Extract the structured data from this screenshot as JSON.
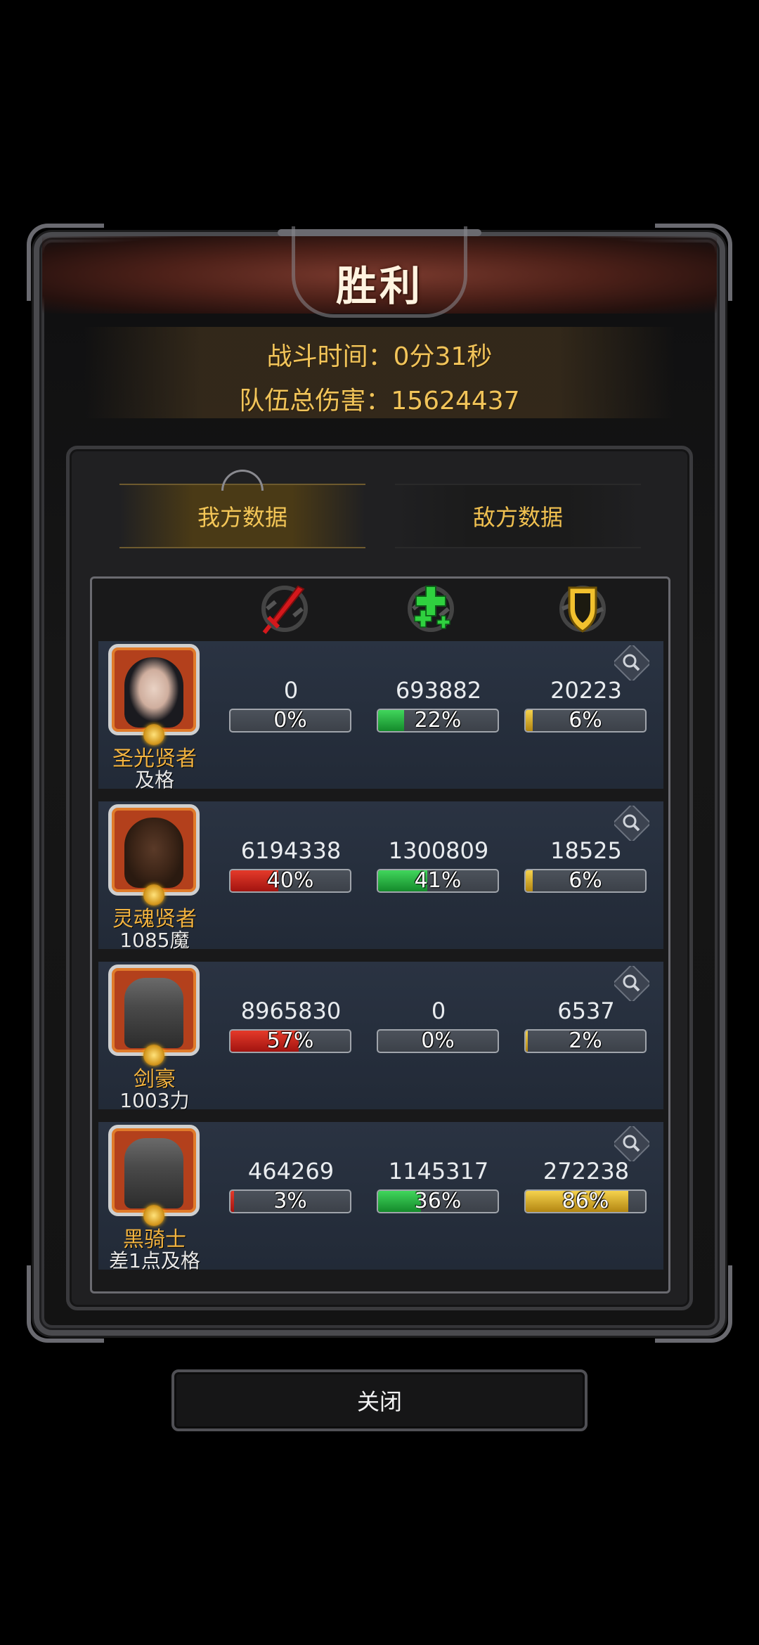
{
  "header": {
    "title": "胜利",
    "battle_time": "战斗时间：0分31秒",
    "total_damage": "队伍总伤害：15624437"
  },
  "tabs": [
    {
      "label": "我方数据",
      "active": true
    },
    {
      "label": "敌方数据",
      "active": false
    }
  ],
  "columns": [
    {
      "icon": "sword-icon",
      "meaning": "damage",
      "color": "#d4181c"
    },
    {
      "icon": "heal-cross-icon",
      "meaning": "healing",
      "color": "#2fd13f"
    },
    {
      "icon": "shield-icon",
      "meaning": "damage-taken",
      "color": "#f2c12e"
    }
  ],
  "heroes": [
    {
      "name": "圣光贤者",
      "score": "及格",
      "damage": {
        "value": "0",
        "percent": "0%",
        "fill": 0
      },
      "heal": {
        "value": "693882",
        "percent": "22%",
        "fill": 0.22
      },
      "tank": {
        "value": "20223",
        "percent": "6%",
        "fill": 0.06
      }
    },
    {
      "name": "灵魂贤者",
      "score": "1085魔",
      "damage": {
        "value": "6194338",
        "percent": "40%",
        "fill": 0.4
      },
      "heal": {
        "value": "1300809",
        "percent": "41%",
        "fill": 0.41
      },
      "tank": {
        "value": "18525",
        "percent": "6%",
        "fill": 0.06
      }
    },
    {
      "name": "剑豪",
      "score": "1003力",
      "damage": {
        "value": "8965830",
        "percent": "57%",
        "fill": 0.57
      },
      "heal": {
        "value": "0",
        "percent": "0%",
        "fill": 0
      },
      "tank": {
        "value": "6537",
        "percent": "2%",
        "fill": 0.02
      }
    },
    {
      "name": "黑骑士",
      "score": "差1点及格",
      "damage": {
        "value": "464269",
        "percent": "3%",
        "fill": 0.03
      },
      "heal": {
        "value": "1145317",
        "percent": "36%",
        "fill": 0.36
      },
      "tank": {
        "value": "272238",
        "percent": "86%",
        "fill": 0.86
      }
    }
  ],
  "close_button": "关闭"
}
